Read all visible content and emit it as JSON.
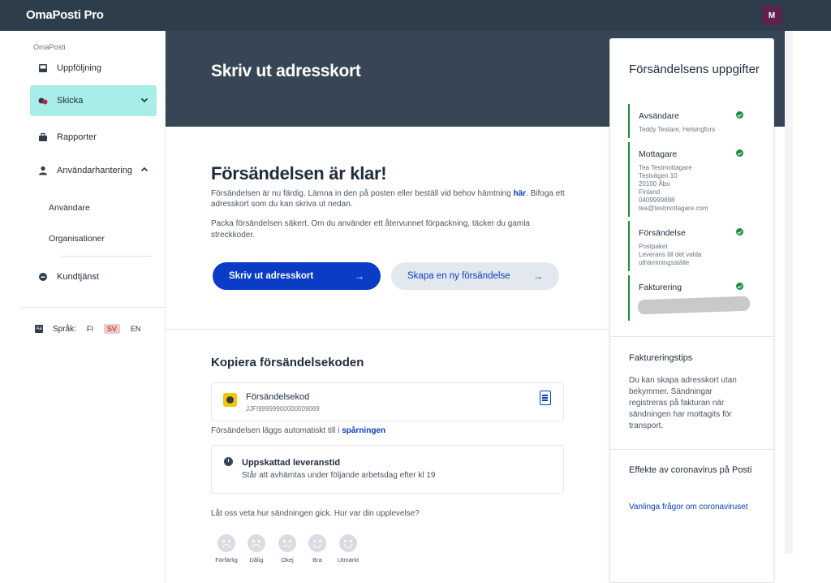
{
  "topbar": {
    "brand": "OmaPosti Pro",
    "avatar": "M"
  },
  "sidebar": {
    "section_label": "OmaPosti",
    "items": [
      {
        "label": "Uppföljning",
        "icon": "inbox-icon"
      },
      {
        "label": "Skicka",
        "icon": "send-icon",
        "active": true,
        "chevron": "chevron-down-icon"
      },
      {
        "label": "Rapporter",
        "icon": "briefcase-icon"
      },
      {
        "label": "Användarhantering",
        "icon": "user-icon",
        "chevron": "chevron-up-icon"
      }
    ],
    "subitems": [
      "Användare",
      "Organisationer"
    ],
    "support": {
      "label": "Kundtjänst",
      "icon": "support-icon"
    },
    "language": {
      "label": "Språk:",
      "options": [
        "FI",
        "SV",
        "EN"
      ],
      "selected": "SV"
    }
  },
  "main": {
    "hero_title": "Skriv ut adresskort",
    "ready_title": "Försändelsen är klar!",
    "ready_text_1": "Försändelsen är nu färdig. Lämna in den på posten eller beställ vid behov hämtning",
    "ready_text_link": "här",
    "ready_text_2": ". Bifoga ett adresskort som du kan skriva ut nedan.",
    "pack_text": "Packa försändelsen säkert. Om du använder ett återvunnet förpackning, täcker du gamla streckkoder.",
    "primary_button": "Skriv ut adresskort",
    "secondary_button": "Skapa en ny försändelse",
    "copy_title": "Kopiera försändelsekoden",
    "code_label": "Försändelsekod",
    "code_value": "JJFI99999900000009069",
    "track_text": "Försändelsen läggs automatiskt till i",
    "track_link": "spårningen",
    "estimate_title": "Uppskattad leveranstid",
    "estimate_text": "Står att avhämtas under följande arbetsdag efter kl 19",
    "feedback_question": "Låt oss veta hur sändningen gick. Hur var din upplevelse?",
    "feedback": [
      {
        "label": "Förfärlig",
        "icon": "very-sad-face-icon"
      },
      {
        "label": "Dålig",
        "icon": "sad-face-icon"
      },
      {
        "label": "Okej",
        "icon": "neutral-face-icon"
      },
      {
        "label": "Bra",
        "icon": "happy-face-icon"
      },
      {
        "label": "Utmärkt",
        "icon": "very-happy-face-icon"
      }
    ]
  },
  "panel": {
    "title": "Försändelsens uppgifter",
    "steps": [
      {
        "title": "Avsändare",
        "lines": [
          "Teddy Testare, Helsingfors"
        ]
      },
      {
        "title": "Mottagare",
        "lines": [
          "Tea Testmottagare",
          "Testvägen 10",
          "20100 Åbo",
          "Finland",
          "0409999888",
          "tea@testmottagare.com"
        ]
      },
      {
        "title": "Försändelse",
        "lines": [
          "Postpaket",
          "Leverans till det valda uthämtningsställe"
        ]
      },
      {
        "title": "Fakturering",
        "lines": []
      }
    ],
    "tips_title": "Faktureringstips",
    "tips_text": "Du kan skapa adresskort utan bekymmer. Sändningar registreras på fakturan när sändningen har mottagits för transport.",
    "corona_title": "Effekte av coronavirus på Posti",
    "corona_link": "Vanlinga frågor om coronaviruset"
  },
  "colors": {
    "topbar": "#2e3d4a",
    "hero": "#374655",
    "accent": "#0a3cc5",
    "active_nav": "#a9ede8",
    "success": "#1d8f3a"
  }
}
